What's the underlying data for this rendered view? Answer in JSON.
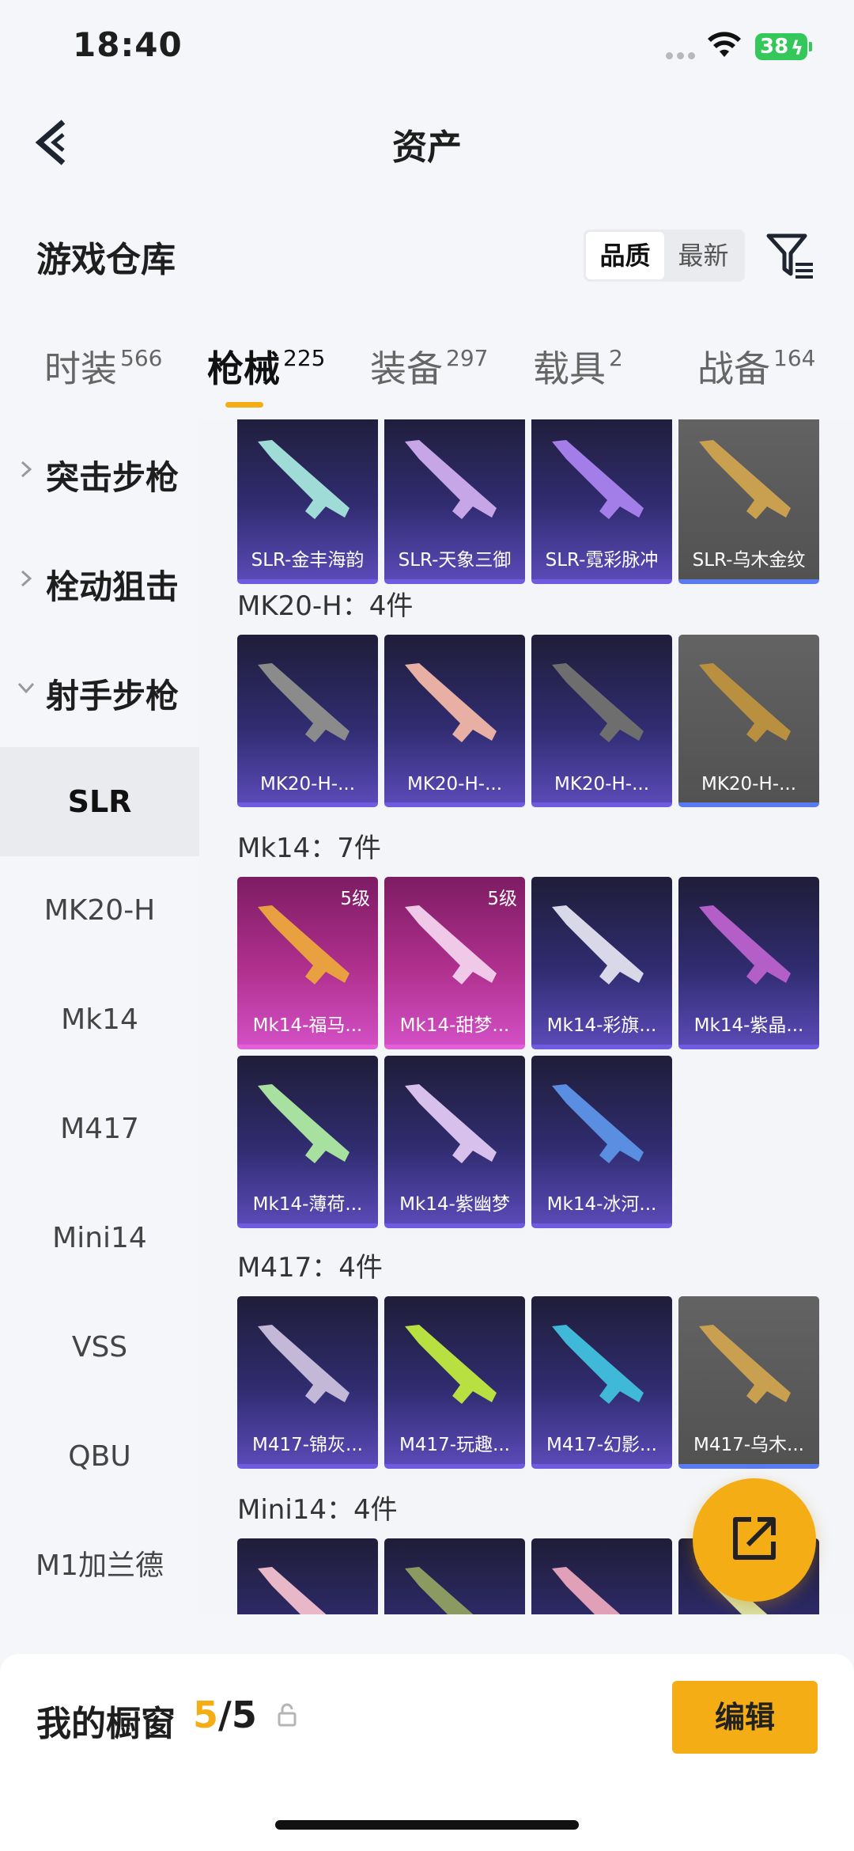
{
  "status_bar": {
    "time": "18:40",
    "battery": "38"
  },
  "nav": {
    "title": "资产"
  },
  "warehouse": {
    "title": "游戏仓库",
    "sort_options": [
      "品质",
      "最新"
    ]
  },
  "tabs": [
    {
      "label": "时装",
      "count": "566"
    },
    {
      "label": "枪械",
      "count": "225"
    },
    {
      "label": "装备",
      "count": "297"
    },
    {
      "label": "载具",
      "count": "2"
    },
    {
      "label": "战备",
      "count": "164"
    }
  ],
  "sidebar": {
    "categories": [
      "突击步枪",
      "栓动狙击",
      "射手步枪"
    ],
    "subitems": [
      "SLR",
      "MK20-H",
      "Mk14",
      "M417",
      "Mini14",
      "VSS",
      "QBU",
      "M1加兰德"
    ]
  },
  "content": {
    "slr_row": [
      "SLR-金丰海韵",
      "SLR-天象三御",
      "SLR-霓彩脉冲",
      "SLR-乌木金纹"
    ],
    "groups": [
      {
        "title": "MK20-H：4件",
        "items": [
          "MK20-H-...",
          "MK20-H-...",
          "MK20-H-...",
          "MK20-H-..."
        ]
      },
      {
        "title": "Mk14：7件",
        "items": [
          "Mk14-福马...",
          "Mk14-甜梦...",
          "Mk14-彩旗...",
          "Mk14-紫晶...",
          "Mk14-薄荷...",
          "Mk14-紫幽梦",
          "Mk14-冰河..."
        ],
        "levels": [
          "5级",
          "5级"
        ]
      },
      {
        "title": "M417：4件",
        "items": [
          "M417-锦灰...",
          "M417-玩趣...",
          "M417-幻影...",
          "M417-乌木..."
        ]
      },
      {
        "title": "Mini14：4件"
      }
    ]
  },
  "showcase": {
    "label": "我的橱窗",
    "current": "5",
    "total": "/5",
    "edit_label": "编辑"
  },
  "colors": {
    "accent": "#f5ad15",
    "rare": "#3b3490",
    "epic": "#c03fa8",
    "plain": "#5a5a5a"
  }
}
